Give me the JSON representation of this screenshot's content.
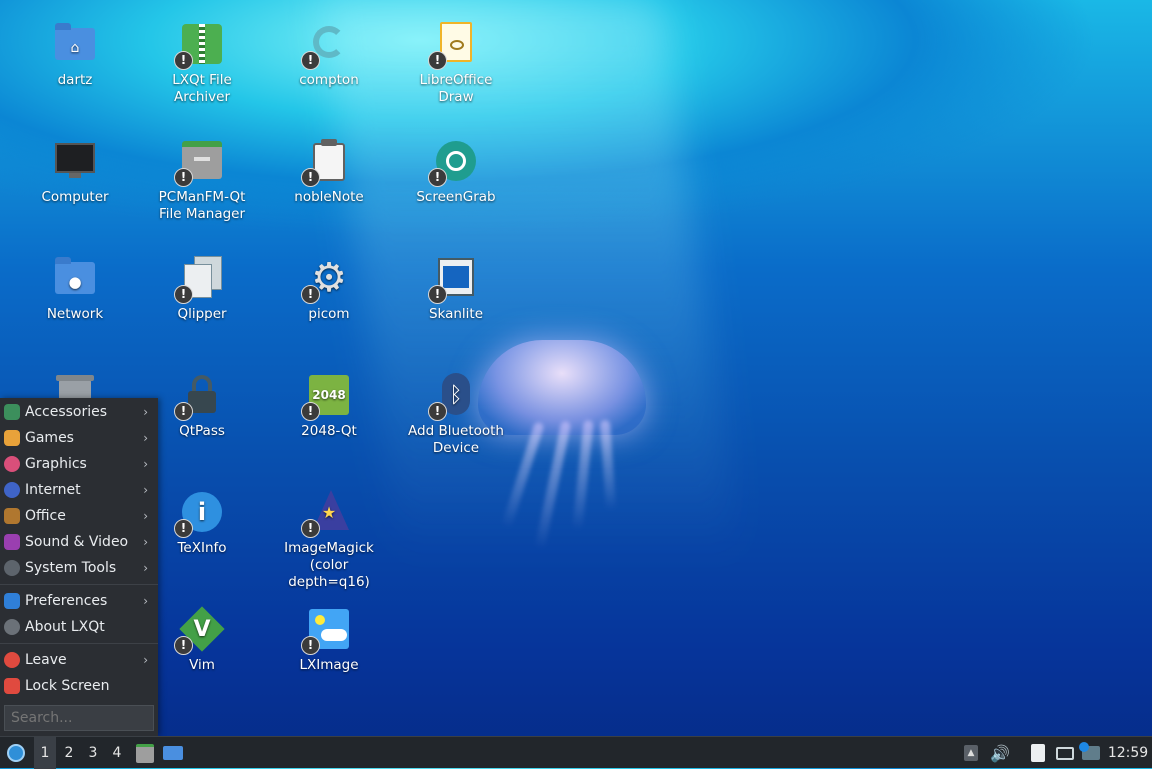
{
  "desktop": {
    "icons": [
      {
        "label": "dartz",
        "kind": "home-folder-icon"
      },
      {
        "label": "LXQt File Archiver",
        "kind": "archiver-icon"
      },
      {
        "label": "compton",
        "kind": "compton-icon"
      },
      {
        "label": "LibreOffice Draw",
        "kind": "libreoffice-draw-icon"
      },
      {
        "label": "Computer",
        "kind": "computer-icon"
      },
      {
        "label": "PCManFM-Qt File Manager",
        "kind": "file-manager-icon"
      },
      {
        "label": "nobleNote",
        "kind": "notes-icon"
      },
      {
        "label": "ScreenGrab",
        "kind": "screengrab-icon"
      },
      {
        "label": "Network",
        "kind": "network-folder-icon"
      },
      {
        "label": "Qlipper",
        "kind": "clipboard-icon"
      },
      {
        "label": "picom",
        "kind": "gear-icon"
      },
      {
        "label": "Skanlite",
        "kind": "scanner-icon"
      },
      {
        "label": "QtPass",
        "kind": "lock-icon"
      },
      {
        "label": "2048-Qt",
        "kind": "game-2048-icon",
        "art_text": "2048"
      },
      {
        "label": "Add Bluetooth Device",
        "kind": "bluetooth-icon"
      },
      {
        "label": "TeXInfo",
        "kind": "info-icon"
      },
      {
        "label": "ImageMagick (color depth=q16)",
        "kind": "wizard-hat-icon"
      },
      {
        "label": "Vim",
        "kind": "vim-icon"
      },
      {
        "label": "LXImage",
        "kind": "image-viewer-icon"
      }
    ],
    "badge_glyph": "!"
  },
  "menu": {
    "items": [
      {
        "label": "Accessories",
        "icon": "accessories-icon",
        "color": "#3c8f5c",
        "submenu": true
      },
      {
        "label": "Games",
        "icon": "games-icon",
        "color": "#e8a23a",
        "submenu": true
      },
      {
        "label": "Graphics",
        "icon": "graphics-icon",
        "color": "#d94f7a",
        "submenu": true
      },
      {
        "label": "Internet",
        "icon": "internet-icon",
        "color": "#3f64c8",
        "submenu": true
      },
      {
        "label": "Office",
        "icon": "office-icon",
        "color": "#b0772f",
        "submenu": true
      },
      {
        "label": "Sound & Video",
        "icon": "sound-video-icon",
        "color": "#9a3fb0",
        "submenu": true
      },
      {
        "label": "System Tools",
        "icon": "system-tools-icon",
        "color": "#5d646c",
        "submenu": true
      },
      {
        "label": "Preferences",
        "icon": "preferences-icon",
        "color": "#2f7fd8",
        "submenu": true
      },
      {
        "label": "About LXQt",
        "icon": "about-icon",
        "color": "#6b7178",
        "submenu": false
      },
      {
        "label": "Leave",
        "icon": "power-icon",
        "color": "#e04a3f",
        "submenu": true
      },
      {
        "label": "Lock Screen",
        "icon": "lock-screen-icon",
        "color": "#e04a3f",
        "submenu": false
      }
    ],
    "search_placeholder": "Search...",
    "arrow_glyph": "›"
  },
  "taskbar": {
    "desktops": [
      "1",
      "2",
      "3",
      "4"
    ],
    "active_desktop": "1",
    "clock": "12:59"
  }
}
